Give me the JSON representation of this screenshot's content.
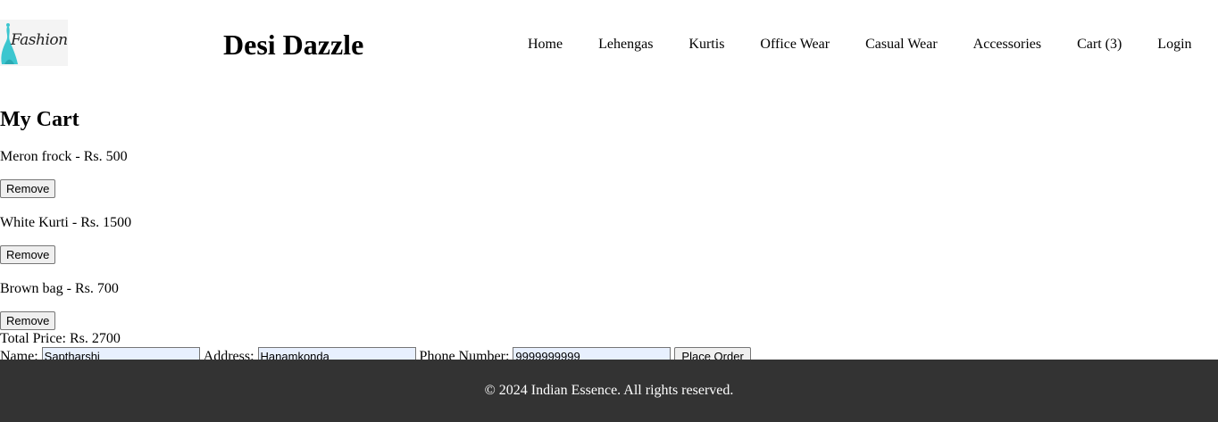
{
  "header": {
    "logo_text": "Fashion",
    "site_title": "Desi Dazzle",
    "nav": [
      {
        "label": "Home"
      },
      {
        "label": "Lehengas"
      },
      {
        "label": "Kurtis"
      },
      {
        "label": "Office Wear"
      },
      {
        "label": "Casual Wear"
      },
      {
        "label": "Accessories"
      },
      {
        "label": "Cart (3)"
      },
      {
        "label": "Login"
      }
    ]
  },
  "cart": {
    "title": "My Cart",
    "items": [
      {
        "text": "Meron frock - Rs. 500",
        "remove_label": "Remove"
      },
      {
        "text": "White Kurti - Rs. 1500",
        "remove_label": "Remove"
      },
      {
        "text": "Brown bag - Rs. 700",
        "remove_label": "Remove"
      }
    ],
    "total": "Total Price: Rs. 2700"
  },
  "order_form": {
    "name_label": "Name:",
    "name_value": "Saptharshi",
    "address_label": "Address:",
    "address_value": "Hanamkonda",
    "phone_label": "Phone Number:",
    "phone_value": "9999999999",
    "submit_label": "Place Order"
  },
  "footer": {
    "text": "© 2024 Indian Essence. All rights reserved."
  },
  "colors": {
    "footer_bg": "#333333",
    "autofill_bg": "#e8f0fe",
    "logo_accent": "#3cc6cf"
  }
}
